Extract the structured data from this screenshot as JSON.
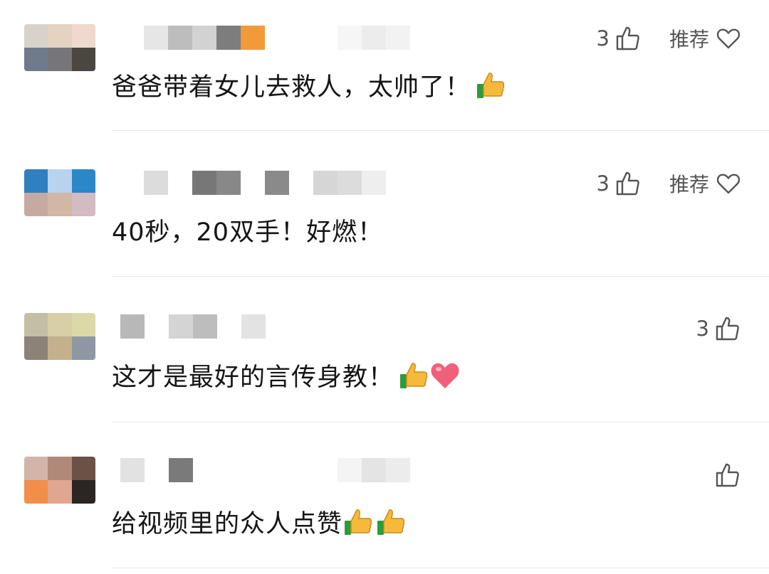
{
  "comments": [
    {
      "text": "爸爸带着女儿去救人，太帅了！",
      "likes": "3",
      "recommend_label": "推荐",
      "emojis": [
        "thumbs-up-emoji"
      ],
      "avatar_colors": [
        "#d7d2ca",
        "#e3d3c0",
        "#efd9ce",
        "#6f7a8c",
        "#75757a",
        "#4a4640"
      ]
    },
    {
      "text": "40秒，20双手！好燃！",
      "likes": "3",
      "recommend_label": "推荐",
      "emojis": [],
      "avatar_colors": [
        "#2f7fc1",
        "#b7d3ee",
        "#2d86c8",
        "#c6aaa1",
        "#d1b7a4",
        "#d3bac3"
      ]
    },
    {
      "text": "这才是最好的言传身教！",
      "likes": "3",
      "recommend_label": "",
      "emojis": [
        "thumbs-up-emoji",
        "heart-emoji"
      ],
      "avatar_colors": [
        "#c3bfa5",
        "#d8cfa6",
        "#dcd9a9",
        "#8c8278",
        "#c4b08c",
        "#8e97a4"
      ]
    },
    {
      "text": "给视频里的众人点赞",
      "likes": "",
      "recommend_label": "",
      "emojis": [
        "thumbs-up-emoji",
        "thumbs-up-emoji"
      ],
      "avatar_colors": [
        "#d2b4a8",
        "#b08978",
        "#6a5247",
        "#f08e4a",
        "#e0a690",
        "#2b2524"
      ]
    }
  ],
  "icons": {
    "like": "thumbs-up-outline-icon",
    "recommend": "heart-outline-icon"
  }
}
